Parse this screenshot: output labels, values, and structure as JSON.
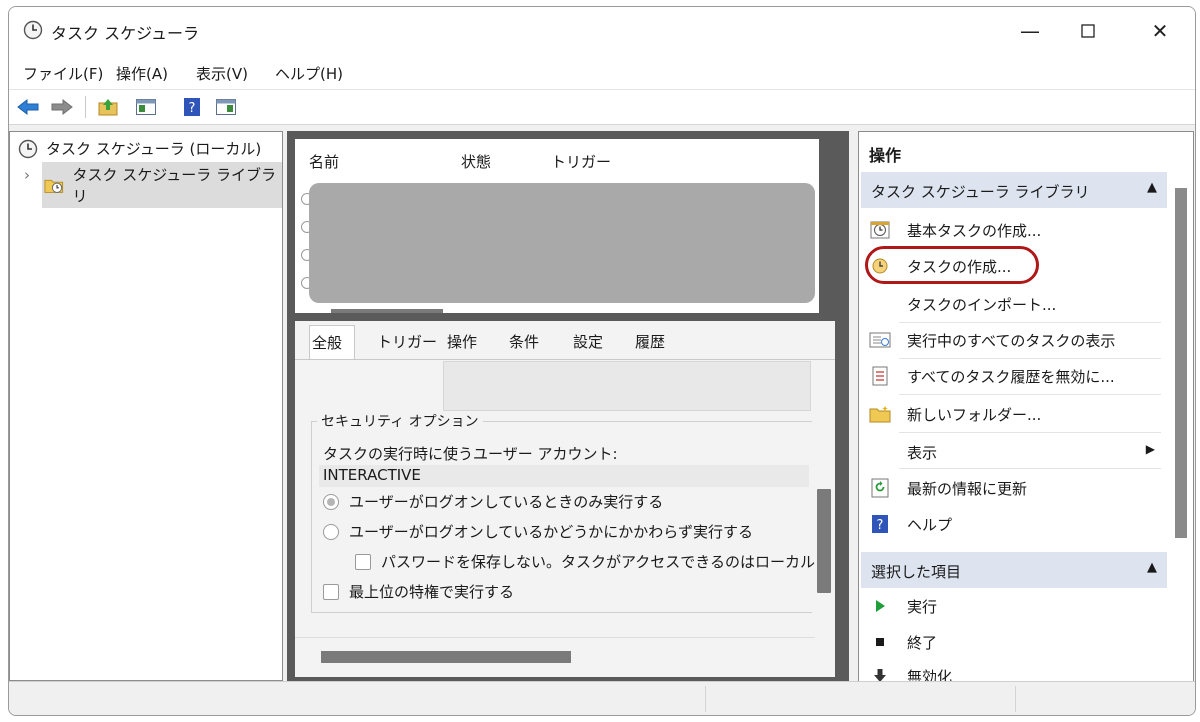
{
  "window": {
    "title": "タスク スケジューラ",
    "minimize_glyph": "—",
    "maximize_glyph": "☐",
    "close_glyph": "✕"
  },
  "menubar": {
    "items": [
      "ファイル(F)",
      "操作(A)",
      "表示(V)",
      "ヘルプ(H)"
    ]
  },
  "toolbar": {
    "buttons": [
      "back-icon",
      "forward-icon",
      "up-folder-icon",
      "show-hide-tree-icon",
      "help-icon",
      "show-hide-action-pane-icon"
    ]
  },
  "tree": {
    "root_label": "タスク スケジューラ (ローカル)",
    "child_label": "タスク スケジューラ ライブラリ",
    "expander": "›"
  },
  "task_list": {
    "columns": [
      "名前",
      "状態",
      "トリガー"
    ]
  },
  "details": {
    "tabs": [
      "全般",
      "トリガー",
      "操作",
      "条件",
      "設定",
      "履歴"
    ],
    "active_tab": "全般",
    "security_group_title": "セキュリティ オプション",
    "account_label": "タスクの実行時に使うユーザー アカウント:",
    "account_value": "INTERACTIVE",
    "radio_logged_on_only": "ユーザーがログオンしているときのみ実行する",
    "radio_whether_logged_on": "ユーザーがログオンしているかどうかにかかわらず実行する",
    "check_no_password": "パスワードを保存しない。タスクがアクセスできるのはローカル！",
    "check_highest_privileges": "最上位の特権で実行する"
  },
  "actions": {
    "title": "操作",
    "library_section": {
      "header": "タスク スケジューラ ライブラリ",
      "items": [
        {
          "label": "基本タスクの作成...",
          "icon": "create-basic-task-icon"
        },
        {
          "label": "タスクの作成...",
          "icon": "create-task-icon",
          "highlighted": true
        },
        {
          "label": "タスクのインポート...",
          "icon": ""
        },
        {
          "label": "実行中のすべてのタスクの表示",
          "icon": "running-tasks-icon"
        },
        {
          "label": "すべてのタスク履歴を無効に...",
          "icon": "task-history-icon"
        },
        {
          "label": "新しいフォルダー...",
          "icon": "new-folder-icon"
        },
        {
          "label": "表示",
          "icon": "",
          "submenu": true
        },
        {
          "label": "最新の情報に更新",
          "icon": "refresh-icon"
        },
        {
          "label": "ヘルプ",
          "icon": "help-icon"
        }
      ]
    },
    "selected_section": {
      "header": "選択した項目",
      "items": [
        {
          "label": "実行",
          "icon": "run-icon"
        },
        {
          "label": "終了",
          "icon": "end-icon"
        },
        {
          "label": "無効化",
          "icon": "disable-icon"
        }
      ]
    }
  },
  "colors": {
    "section_header_bg": "#dde4f0",
    "highlight_ring": "#b01818",
    "run_green": "#1f9e3a"
  }
}
